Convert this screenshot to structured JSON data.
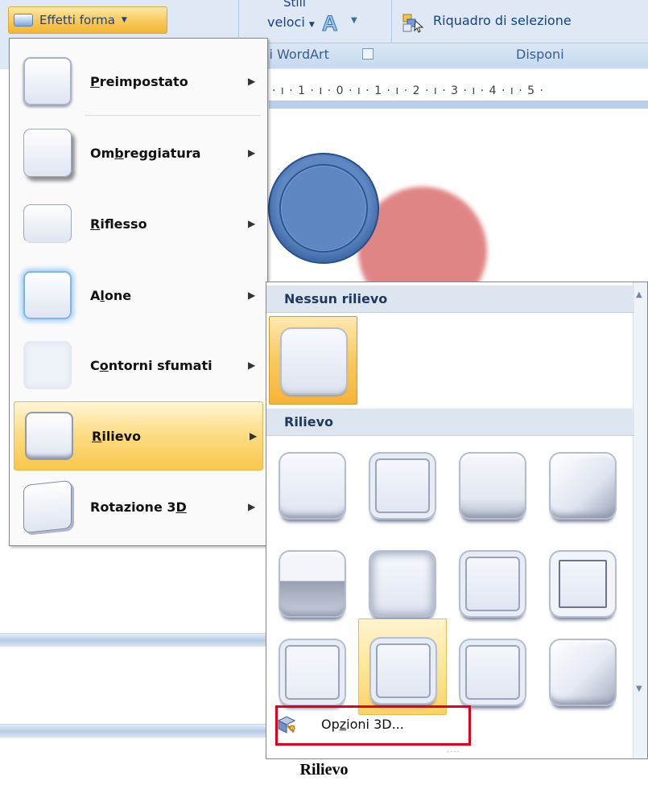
{
  "ribbon": {
    "effects_button_label": "Effetti forma",
    "styles_top": "Stili",
    "styles_veloci": "veloci",
    "wordart_group": "li WordArt",
    "selection_pane": "Riquadro di selezione",
    "arrange_group": "Disponi"
  },
  "ruler": {
    "text": "· ı · 1 · ı · 0 · ı · 1 · ı · 2 · ı · 3 · ı · 4 · ı · 5 ·"
  },
  "menu": {
    "items": [
      {
        "label": "Preimpostato",
        "u": "P",
        "rest": "reimpostato"
      },
      {
        "label": "Ombreggiatura",
        "pre": "Om",
        "u": "b",
        "rest": "reggiatura"
      },
      {
        "label": "Riflesso",
        "u": "R",
        "rest": "iflesso"
      },
      {
        "label": "Alone",
        "pre": "A",
        "u": "l",
        "rest": "one"
      },
      {
        "label": "Contorni sfumati",
        "pre": "C",
        "u": "o",
        "rest": "ntorni sfumati"
      },
      {
        "label": "Rilievo",
        "u": "R",
        "rest": "ilievo"
      },
      {
        "label": "Rotazione 3D",
        "pre": "Rotazione 3",
        "u": "D",
        "rest": ""
      }
    ],
    "arrow": "▶"
  },
  "submenu": {
    "no_bevel_header": "Nessun rilievo",
    "bevel_header": "Rilievo",
    "options_3d": {
      "pre": "Op",
      "u": "z",
      "rest": "ioni 3D..."
    },
    "grip": "····",
    "scroll_up": "▲",
    "scroll_down": "▼"
  },
  "caption": "Rilievo"
}
